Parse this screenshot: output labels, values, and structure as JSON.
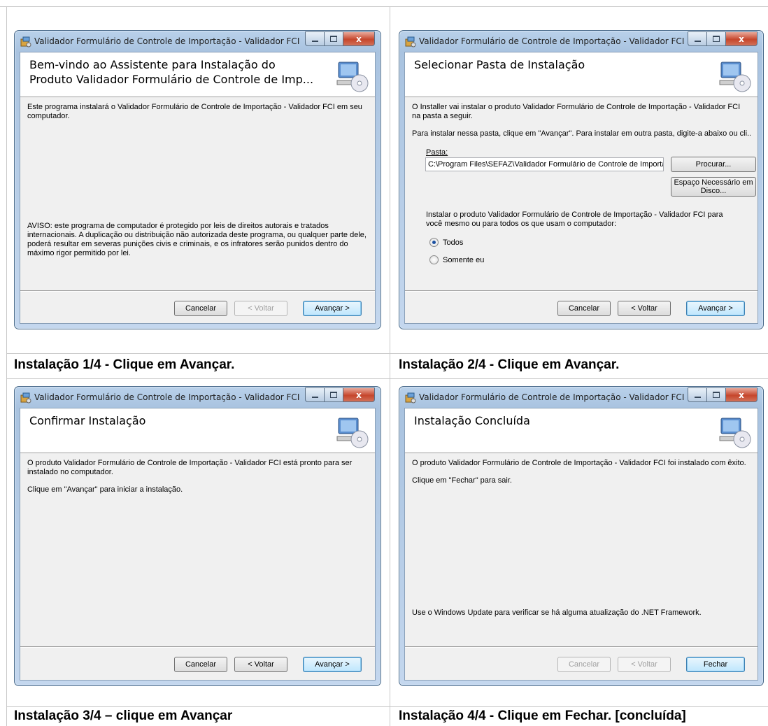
{
  "window_title": "Validador Formulário de Controle de Importação - Validador FCI",
  "close_glyph": "x",
  "steps": [
    {
      "banner_title": "Bem-vindo ao Assistente para Instalação do Produto Validador Formulário de Controle de Imp...",
      "text1": "Este  programa instalará o Validador Formulário de Controle de Importação  - Validador FCI em seu computador.",
      "warning": "AVISO: este programa de computador é protegido por leis de direitos autorais e tratados internacionais. A duplicação ou distribuição não autorizada deste programa, ou qualquer parte dele, poderá resultar em severas punições civis e criminais, e os infratores serão punidos dentro do máximo rigor permitido por lei.",
      "buttons": {
        "cancel": "Cancelar",
        "back": "< Voltar",
        "next": "Avançar >"
      },
      "caption": "Instalação 1/4 - Clique em Avançar."
    },
    {
      "banner_title": "Selecionar Pasta de Instalação",
      "text1": "O Installer vai instalar o produto Validador Formulário de Controle de Importação - Validador FCI na pasta a seguir.",
      "text2": "Para instalar nessa pasta, clique em \"Avançar\". Para instalar em outra pasta, digite-a abaixo ou cli...",
      "folder_label": "Pasta:",
      "folder_value": "C:\\Program Files\\SEFAZ\\Validador Formulário de Controle de Importa",
      "browse": "Procurar...",
      "disk_space": "Espaço Necessário em Disco...",
      "install_for": "Instalar o produto Validador Formulário de Controle de Importação - Validador FCI para você mesmo ou para todos os que usam o computador:",
      "option_all": "Todos",
      "option_me": "Somente eu",
      "selected_option": "Todos",
      "buttons": {
        "cancel": "Cancelar",
        "back": "< Voltar",
        "next": "Avançar >"
      },
      "caption": "Instalação 2/4 - Clique em Avançar."
    },
    {
      "banner_title": "Confirmar Instalação",
      "text1": "O produto Validador Formulário de Controle de Importação - Validador FCI está pronto para ser instalado no computador.",
      "text2": "Clique em \"Avançar\" para iniciar a instalação.",
      "buttons": {
        "cancel": "Cancelar",
        "back": "< Voltar",
        "next": "Avançar >"
      },
      "caption": "Instalação 3/4 – clique em Avançar"
    },
    {
      "banner_title": "Instalação Concluída",
      "text1": "O produto Validador Formulário de Controle de Importação - Validador FCI foi instalado com êxito.",
      "text2": "Clique em \"Fechar\" para sair.",
      "text3": "Use o Windows Update para verificar se há alguma atualização do .NET Framework.",
      "buttons": {
        "cancel": "Cancelar",
        "back": "< Voltar",
        "close": "Fechar"
      },
      "caption": "Instalação 4/4 - Clique em Fechar. [concluída]"
    }
  ]
}
